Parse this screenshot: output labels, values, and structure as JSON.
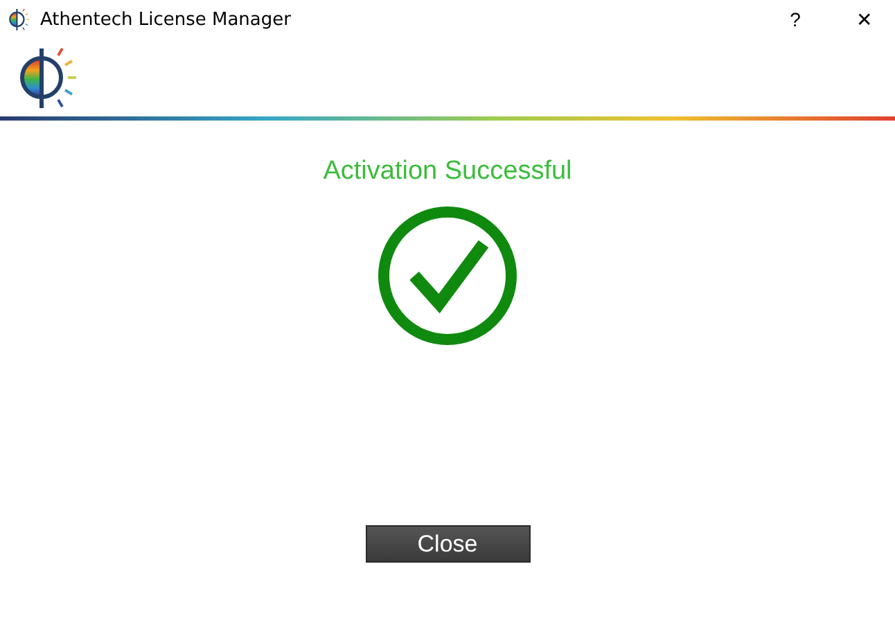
{
  "window": {
    "title": "Athentech License Manager",
    "help": "?",
    "close": "✕"
  },
  "message": "Activation Successful",
  "buttons": [
    "Close"
  ]
}
